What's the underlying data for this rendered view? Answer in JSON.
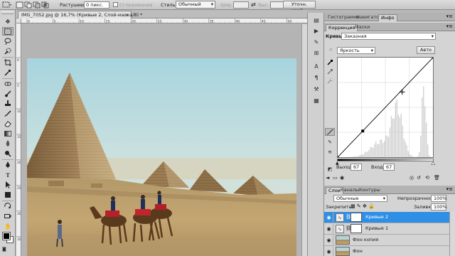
{
  "options_bar": {
    "feather_label": "Растушевка:",
    "feather_value": "0 пикс.",
    "antialias_label": "Сглаживание",
    "style_label": "Стиль:",
    "style_value": "Обычный",
    "width_label": "Шир.:",
    "height_label": "Выс.:",
    "refine_edge": "Уточн. край..."
  },
  "document": {
    "tab_title": "IMG_7052.jpg @ 16,7% (Кривые 2, Слой-маска/8) *",
    "close_glyph": "×",
    "ruler_top_ticks": [
      "0",
      "5",
      "10",
      "15",
      "20",
      "25",
      "30",
      "35",
      "40",
      "45",
      "50"
    ],
    "ruler_left_ticks": [
      "0",
      "5",
      "10",
      "15",
      "20",
      "25",
      "30",
      "35"
    ]
  },
  "panels": {
    "top_tabs": [
      "Гистограмма",
      "Навигатор",
      "Инфо"
    ],
    "correction_tabs": [
      "Коррекция",
      "Маски"
    ],
    "menu_glyph": "▾≡"
  },
  "curves": {
    "adjustment_label": "Кривые",
    "preset_value": "Заказная",
    "channel_value": "Яркость",
    "auto_button": "Авто",
    "output_label": "Выход:",
    "output_value": "67",
    "input_label": "Вход:",
    "input_value": "67",
    "control_point": {
      "input": 67,
      "output": 67
    }
  },
  "layers": {
    "tabs": [
      "Слои",
      "Каналы",
      "Контуры"
    ],
    "blend_mode": "Обычные",
    "opacity_label": "Непрозрачность:",
    "opacity_value": "100%",
    "lock_label": "Закрепить:",
    "fill_label": "Заливка:",
    "fill_value": "100%",
    "items": [
      {
        "name": "Кривые 2",
        "selected": true,
        "type": "adjustment"
      },
      {
        "name": "Кривые 1",
        "selected": false,
        "type": "adjustment"
      },
      {
        "name": "Фон копия",
        "selected": false,
        "type": "image"
      },
      {
        "name": "Фон",
        "selected": false,
        "type": "image"
      }
    ]
  },
  "colors": {
    "selection_blue": "#2f8fe6",
    "panel_bg": "#d4d4d4",
    "canvas_bg": "#b4b4b4"
  },
  "icons": {
    "toolbox": [
      "move-tool-icon",
      "marquee-tool-icon",
      "lasso-tool-icon",
      "quick-select-tool-icon",
      "crop-tool-icon",
      "eyedropper-tool-icon",
      "healing-brush-tool-icon",
      "brush-tool-icon",
      "clone-stamp-tool-icon",
      "history-brush-tool-icon",
      "eraser-tool-icon",
      "gradient-tool-icon",
      "blur-tool-icon",
      "dodge-tool-icon",
      "pen-tool-icon",
      "type-tool-icon",
      "path-select-tool-icon",
      "shape-tool-icon",
      "3d-rotate-tool-icon",
      "3d-camera-tool-icon",
      "hand-tool-icon",
      "zoom-tool-icon"
    ]
  }
}
